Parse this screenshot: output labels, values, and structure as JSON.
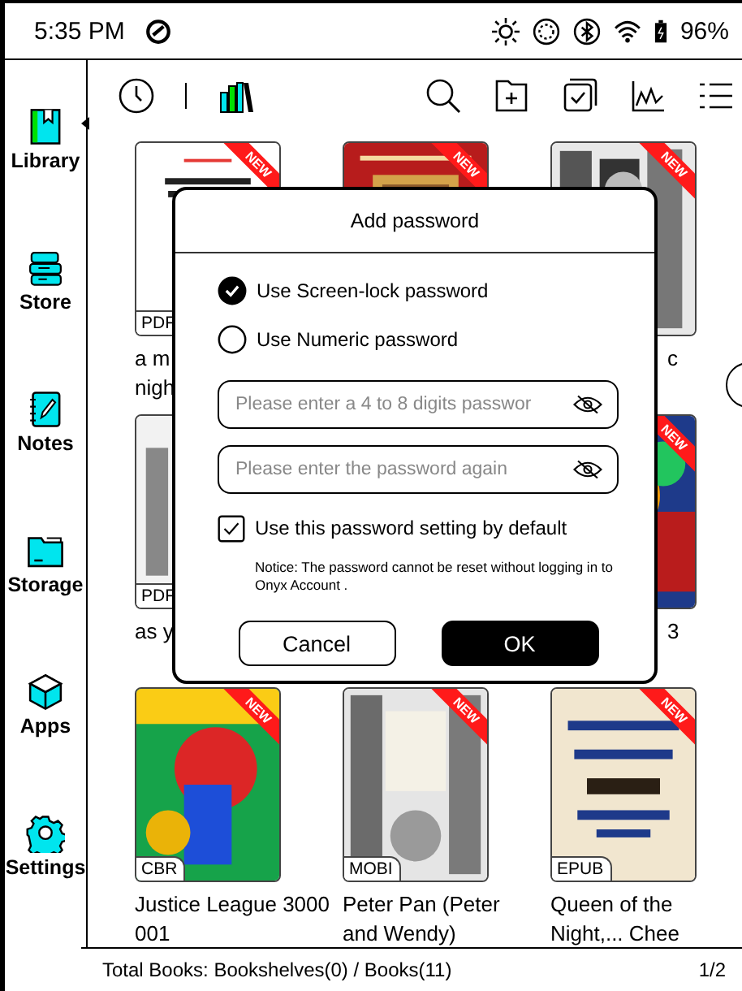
{
  "status_bar": {
    "time": "5:35 PM",
    "battery": "96%"
  },
  "sidebar": {
    "items": [
      {
        "label": "Library",
        "selected": true
      },
      {
        "label": "Store",
        "selected": false
      },
      {
        "label": "Notes",
        "selected": false
      },
      {
        "label": "Storage",
        "selected": false
      },
      {
        "label": "Apps",
        "selected": false
      },
      {
        "label": "Settings",
        "selected": false
      }
    ]
  },
  "books": [
    {
      "badge": "NEW",
      "format": "PDF",
      "title": "a m\nnigh"
    },
    {
      "badge": "NEW"
    },
    {
      "badge": "NEW",
      "title": "c",
      "covered": true
    },
    {
      "format": "PDF",
      "title": "as y"
    },
    {
      "cover": {
        "kind": "hidden"
      }
    },
    {
      "badge": "NEW",
      "title": "3",
      "covered": true
    },
    {
      "badge": "NEW",
      "format": "CBR",
      "title": "Justice League 3000 001"
    },
    {
      "badge": "NEW",
      "format": "MOBI",
      "title": "Peter Pan (Peter and Wendy)"
    },
    {
      "badge": "NEW",
      "format": "EPUB",
      "title": "Queen of the Night,... Chee"
    }
  ],
  "dialog": {
    "title": "Add password",
    "options": [
      {
        "label": "Use Screen-lock password",
        "selected": true
      },
      {
        "label": "Use Numeric password",
        "selected": false
      }
    ],
    "fields": [
      {
        "placeholder": "Please enter a 4 to 8 digits passwor"
      },
      {
        "placeholder": "Please enter the password again"
      }
    ],
    "default_setting": {
      "label": "Use this password setting by default",
      "checked": true
    },
    "notice": "Notice: The password cannot be reset without logging in to Onyx Account .",
    "buttons": [
      {
        "label": "Cancel",
        "kind": "secondary"
      },
      {
        "label": "OK",
        "kind": "primary"
      }
    ]
  },
  "footer": {
    "summary": "Total Books: Bookshelves(0) / Books(11)",
    "page": "1/2"
  }
}
